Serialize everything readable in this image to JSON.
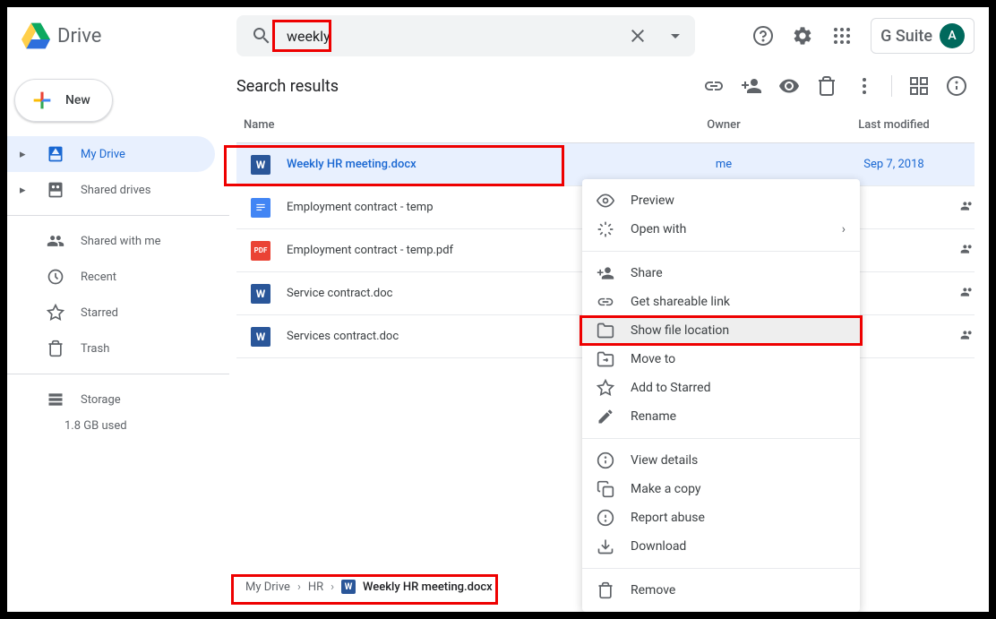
{
  "app": {
    "name": "Drive",
    "gsuite": "G Suite",
    "avatar": "A"
  },
  "search": {
    "value": "weekly"
  },
  "sidebar": {
    "new_label": "New",
    "items": [
      {
        "label": "My Drive"
      },
      {
        "label": "Shared drives"
      },
      {
        "label": "Shared with me"
      },
      {
        "label": "Recent"
      },
      {
        "label": "Starred"
      },
      {
        "label": "Trash"
      },
      {
        "label": "Storage"
      }
    ],
    "storage_used": "1.8 GB used"
  },
  "main": {
    "title": "Search results",
    "columns": {
      "name": "Name",
      "owner": "Owner",
      "modified": "Last modified"
    },
    "files": [
      {
        "name": "Weekly HR meeting.docx",
        "owner": "me",
        "modified": "Sep 7, 2018",
        "type": "docx"
      },
      {
        "name": "Employment contract - temp",
        "type": "docs"
      },
      {
        "name": "Employment contract - temp.pdf",
        "type": "pdf"
      },
      {
        "name": "Service contract.doc",
        "type": "docx"
      },
      {
        "name": "Services contract.doc",
        "type": "docx"
      }
    ]
  },
  "context_menu": {
    "items": [
      {
        "label": "Preview"
      },
      {
        "label": "Open with"
      },
      {
        "label": "Share"
      },
      {
        "label": "Get shareable link"
      },
      {
        "label": "Show file location"
      },
      {
        "label": "Move to"
      },
      {
        "label": "Add to Starred"
      },
      {
        "label": "Rename"
      },
      {
        "label": "View details"
      },
      {
        "label": "Make a copy"
      },
      {
        "label": "Report abuse"
      },
      {
        "label": "Download"
      },
      {
        "label": "Remove"
      }
    ]
  },
  "breadcrumb": {
    "parts": [
      "My Drive",
      "HR",
      "Weekly HR meeting.docx"
    ]
  }
}
